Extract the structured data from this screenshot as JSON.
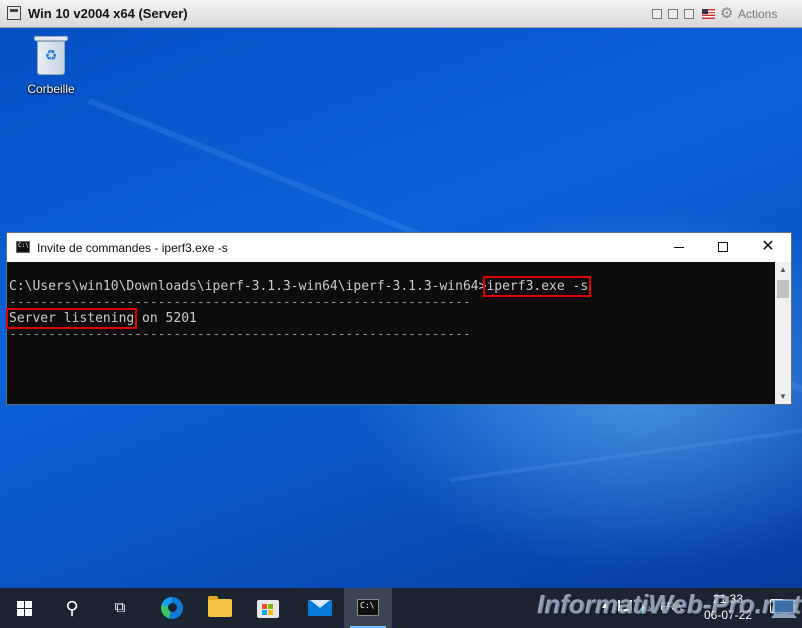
{
  "vm": {
    "title": "Win 10 v2004 x64 (Server)",
    "actions_label": "Actions"
  },
  "desktop": {
    "recycle_bin_label": "Corbeille"
  },
  "cmd": {
    "title": "Invite de commandes - iperf3.exe  -s",
    "lines": {
      "prompt": "C:\\Users\\win10\\Downloads\\iperf-3.1.3-win64\\iperf-3.1.3-win64>",
      "command": "iperf3.exe -s",
      "separator1": "-----------------------------------------------------------",
      "status_highlight": "Server listening",
      "status_rest": " on 5201",
      "separator2": "-----------------------------------------------------------"
    },
    "highlight_color": "#e00000"
  },
  "taskbar": {
    "language": "FRA",
    "time": "21:33",
    "date": "06-07-22"
  },
  "watermark": "InformatiWeb-Pro.net",
  "colors": {
    "desktop_blue": "#0b62d8",
    "taskbar": "#1b2430",
    "console_bg": "#0c0c0c",
    "console_text": "#cccccc"
  }
}
